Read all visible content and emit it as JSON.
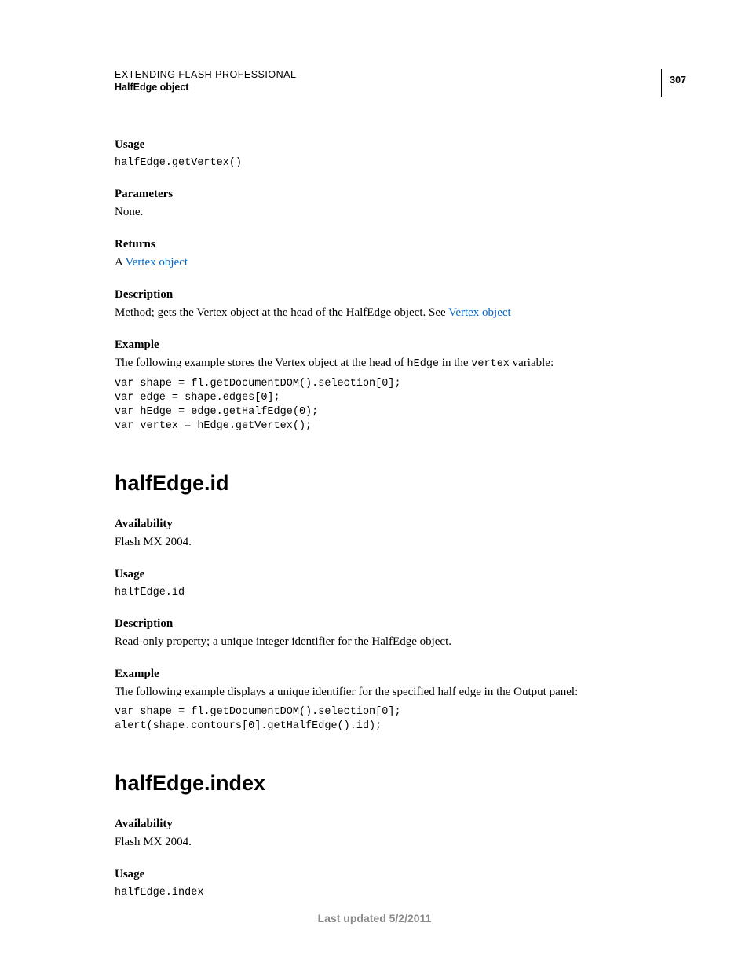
{
  "header": {
    "doc_title": "EXTENDING FLASH PROFESSIONAL",
    "subtitle": "HalfEdge object",
    "page_number": "307"
  },
  "section1": {
    "usage_label": "Usage",
    "usage_code": "halfEdge.getVertex()",
    "parameters_label": "Parameters",
    "parameters_text": "None.",
    "returns_label": "Returns",
    "returns_prefix": "A ",
    "returns_link": "Vertex object",
    "description_label": "Description",
    "description_prefix": "Method; gets the Vertex object at the head of the HalfEdge object. See ",
    "description_link": "Vertex object",
    "example_label": "Example",
    "example_text_a": "The following example stores the Vertex object at the head of ",
    "example_code_a": "hEdge",
    "example_text_b": " in the ",
    "example_code_b": "vertex",
    "example_text_c": " variable:",
    "example_block": "var shape = fl.getDocumentDOM().selection[0]; \nvar edge = shape.edges[0]; \nvar hEdge = edge.getHalfEdge(0); \nvar vertex = hEdge.getVertex();"
  },
  "section2": {
    "heading": "halfEdge.id",
    "availability_label": "Availability",
    "availability_text": "Flash MX 2004.",
    "usage_label": "Usage",
    "usage_code": "halfEdge.id",
    "description_label": "Description",
    "description_text": "Read-only property; a unique integer identifier for the HalfEdge object.",
    "example_label": "Example",
    "example_text": "The following example displays a unique identifier for the specified half edge in the Output panel:",
    "example_block": "var shape = fl.getDocumentDOM().selection[0]; \nalert(shape.contours[0].getHalfEdge().id);"
  },
  "section3": {
    "heading": "halfEdge.index",
    "availability_label": "Availability",
    "availability_text": "Flash MX 2004.",
    "usage_label": "Usage",
    "usage_code": "halfEdge.index"
  },
  "footer": "Last updated 5/2/2011"
}
